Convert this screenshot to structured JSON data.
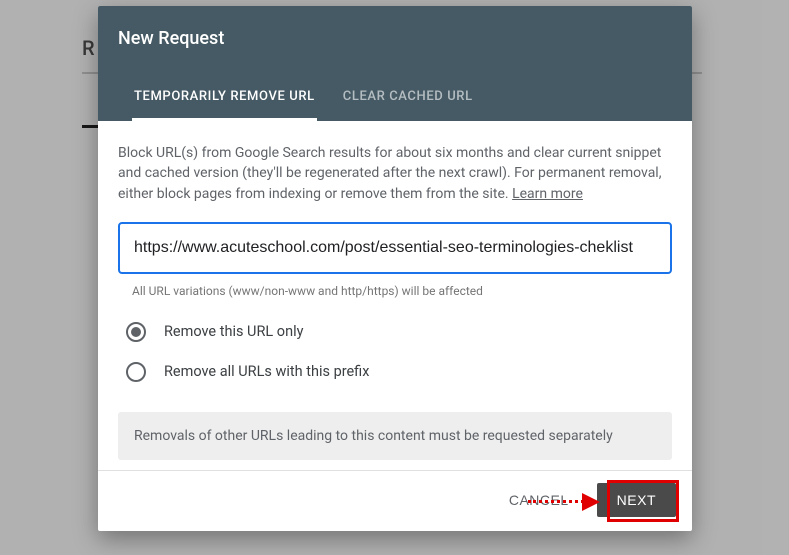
{
  "background": {
    "partial_text": "R"
  },
  "dialog": {
    "title": "New Request",
    "tabs": {
      "remove": "TEMPORARILY REMOVE URL",
      "clear": "CLEAR CACHED URL"
    },
    "description_prefix": "Block URL(s) from Google Search results for about six months and clear current snippet and cached version (they'll be regenerated after the next crawl). For permanent removal, either block pages from indexing or remove them from the site. ",
    "learn_more": "Learn more",
    "url_value": "https://www.acuteschool.com/post/essential-seo-terminologies-cheklist",
    "helper": "All URL variations (www/non-www and http/https) will be affected",
    "option_only": "Remove this URL only",
    "option_prefix": "Remove all URLs with this prefix",
    "note": "Removals of other URLs leading to this content must be requested separately",
    "cancel": "CANCEL",
    "next": "NEXT"
  }
}
